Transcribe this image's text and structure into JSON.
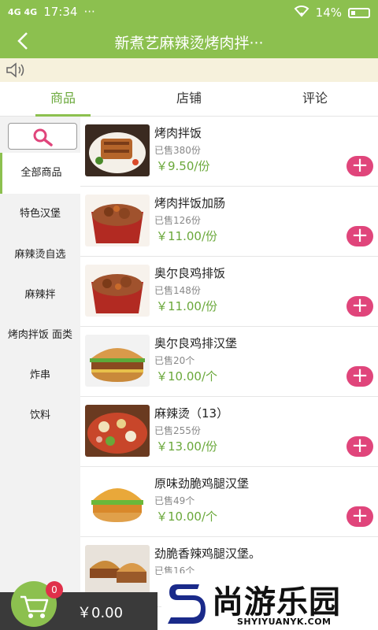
{
  "status_bar": {
    "signal": "4G 4G",
    "time": "17:34",
    "more": "···",
    "battery": "14%"
  },
  "header": {
    "title": "新煮艺麻辣烫烤肉拌···"
  },
  "tabs": [
    "商品",
    "店铺",
    "评论"
  ],
  "sidebar": {
    "categories": [
      "全部商品",
      "特色汉堡",
      "麻辣烫自选",
      "麻辣拌",
      "烤肉拌饭 面类",
      "炸串",
      "饮料"
    ]
  },
  "products": [
    {
      "name": "烤肉拌饭",
      "sold": "已售380份",
      "price": "￥9.50/份",
      "image_icon": "rice-bowl-icon"
    },
    {
      "name": "烤肉拌饭加肠",
      "sold": "已售126份",
      "price": "￥11.00/份",
      "image_icon": "rice-box-icon"
    },
    {
      "name": "奥尔良鸡排饭",
      "sold": "已售148份",
      "price": "￥11.00/份",
      "image_icon": "rice-box-icon"
    },
    {
      "name": "奥尔良鸡排汉堡",
      "sold": "已售20个",
      "price": "￥10.00/个",
      "image_icon": "burger-icon"
    },
    {
      "name": "麻辣烫（13）",
      "sold": "已售255份",
      "price": "￥13.00/份",
      "image_icon": "hotpot-icon"
    },
    {
      "name": "原味劲脆鸡腿汉堡",
      "sold": "已售49个",
      "price": "￥10.00/个",
      "image_icon": "burger-icon"
    },
    {
      "name": "劲脆香辣鸡腿汉堡。",
      "sold": "已售16个",
      "price": "",
      "image_icon": "burger-icon"
    }
  ],
  "cart": {
    "count": "0",
    "total": "￥0.00"
  },
  "watermark": {
    "cn": "尚游乐园",
    "en": "SHYIYUANYK.COM"
  },
  "colors": {
    "brand_green": "#8cc04f",
    "price_green": "#6aa83a",
    "add_pink": "#e0457b",
    "cart_dark": "#3a3a3a"
  }
}
